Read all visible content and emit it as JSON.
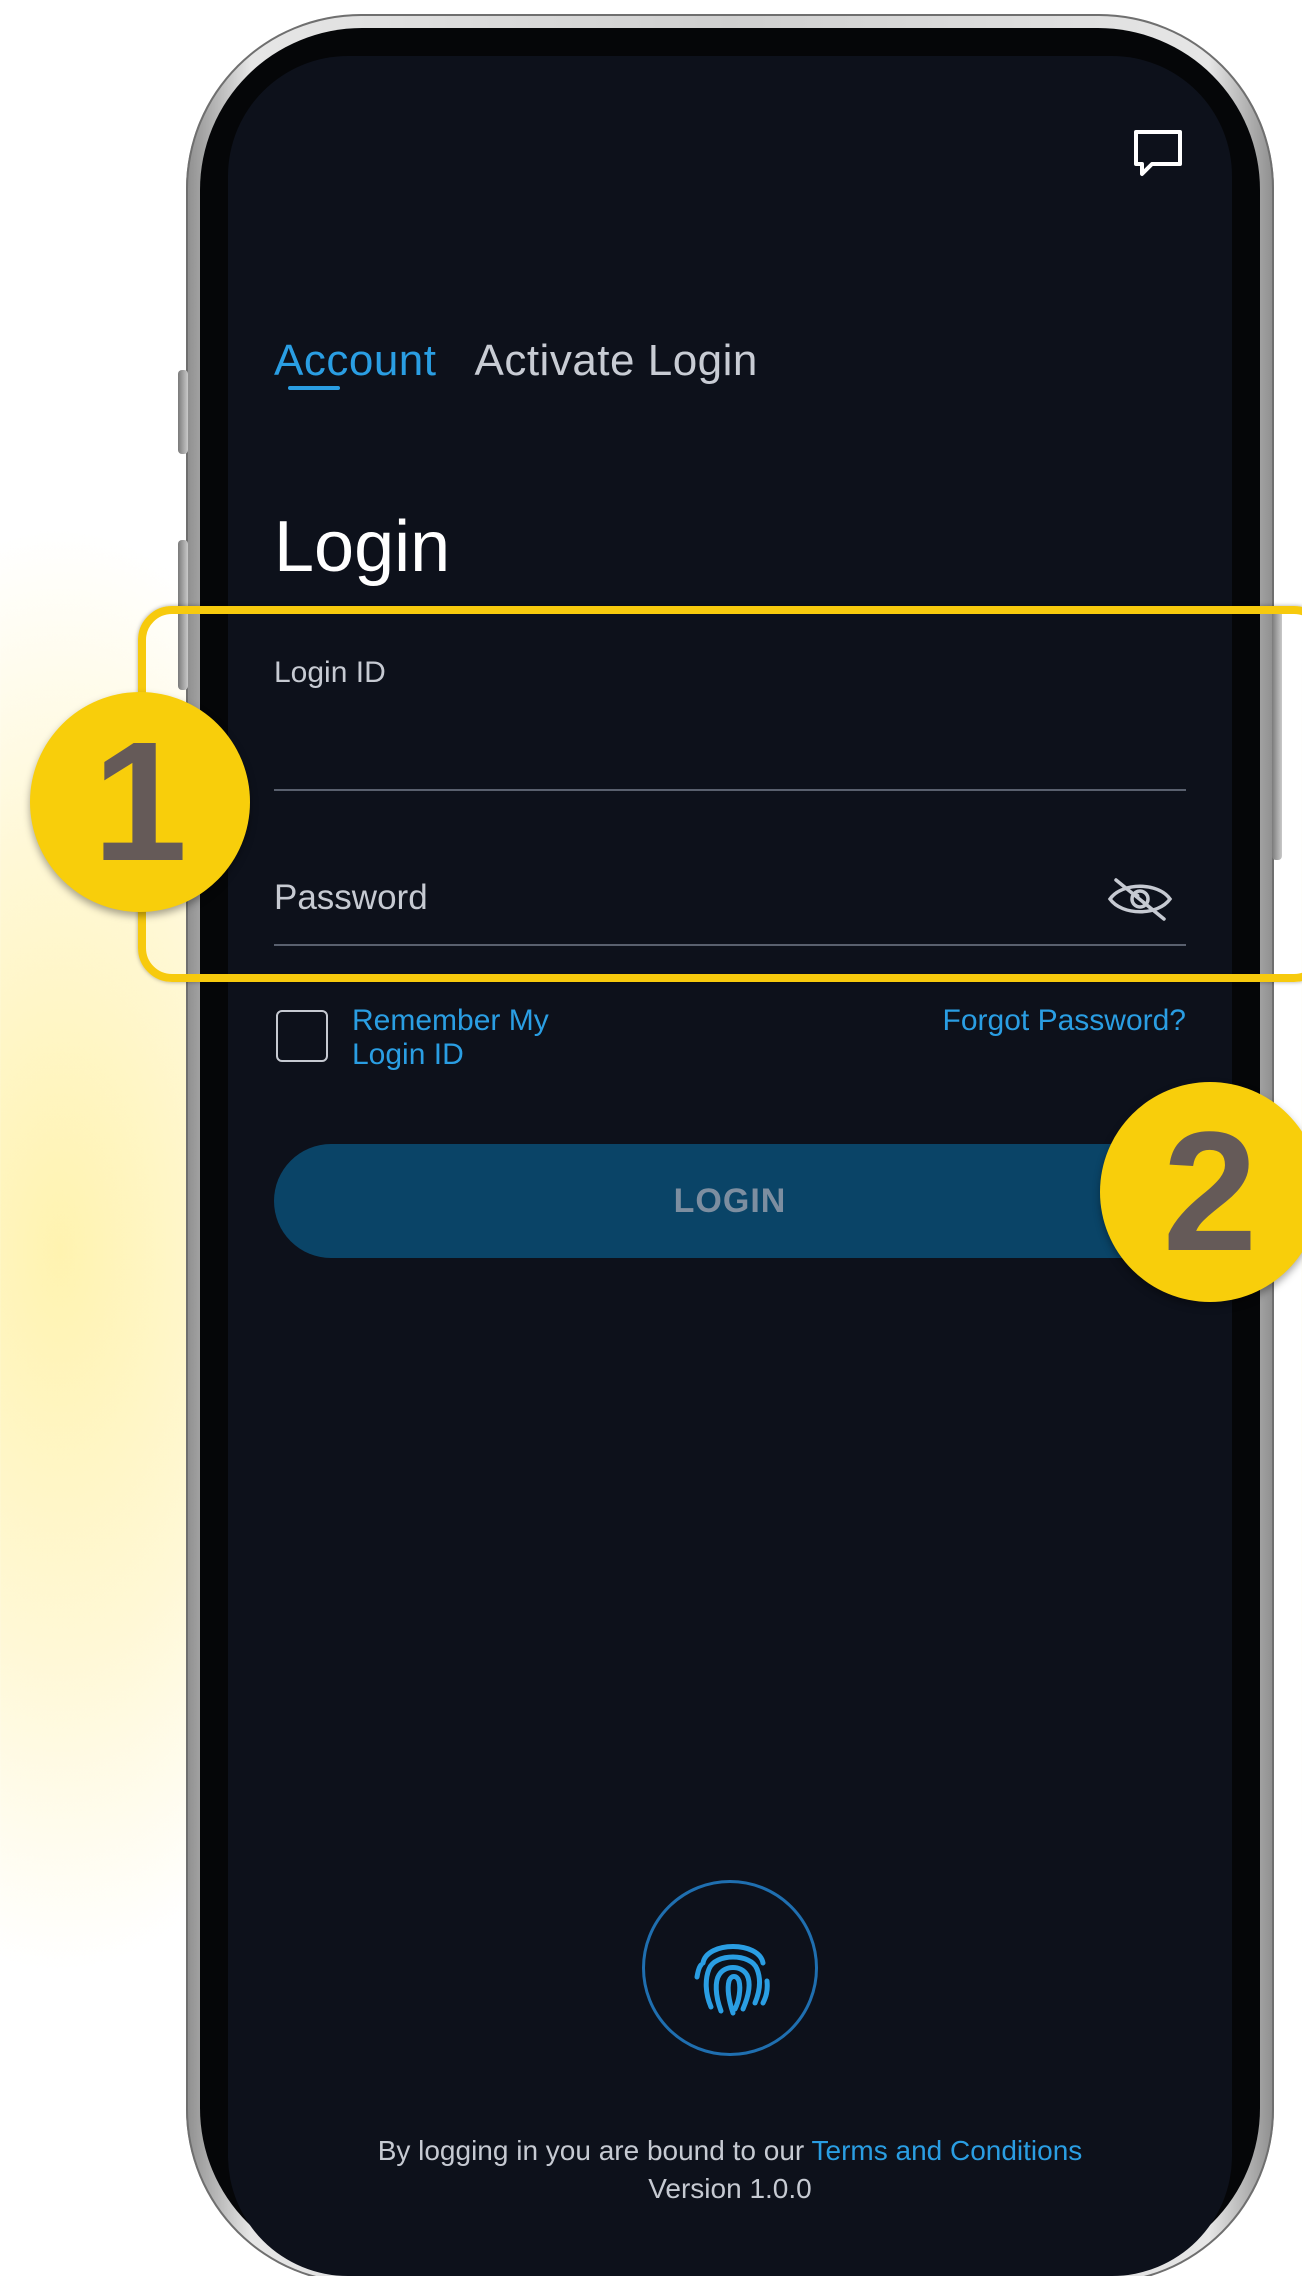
{
  "header": {
    "feedback_icon": "chat-bubble-icon"
  },
  "tabs": [
    {
      "label": "Account",
      "active": true
    },
    {
      "label": "Activate Login",
      "active": false
    }
  ],
  "title": "Login",
  "form": {
    "login_id_label": "Login ID",
    "login_id_value": "",
    "password_label": "Password",
    "password_value": "",
    "password_toggle_icon": "eye-slash-icon",
    "remember_label": "Remember My Login ID",
    "remember_checked": false,
    "forgot_password": "Forgot Password?",
    "login_button": "LOGIN"
  },
  "biometric": {
    "icon": "fingerprint-icon"
  },
  "footer": {
    "terms_prefix": "By logging in you are bound to our",
    "terms_link": "Terms and Conditions",
    "version": "Version 1.0.0"
  },
  "annotations": {
    "badge_1": "1",
    "badge_2": "2"
  },
  "colors": {
    "screen_bg": "#0d111b",
    "accent": "#2a9ee3",
    "button_bg": "#0a4467",
    "annotation": "#f8ce0b"
  }
}
